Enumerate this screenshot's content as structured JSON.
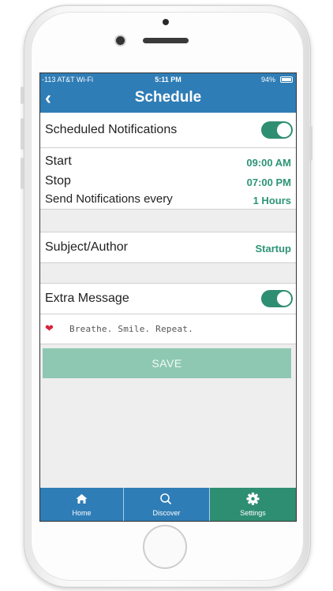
{
  "status_bar": {
    "carrier": "-113 AT&T Wi-Fi",
    "time": "5:11 PM",
    "battery": "94%"
  },
  "nav": {
    "back_icon": "chevron-left-icon",
    "title": "Schedule"
  },
  "settings": {
    "scheduled_notifications": {
      "label": "Scheduled Notifications",
      "enabled": true
    },
    "start": {
      "label": "Start",
      "value": "09:00 AM"
    },
    "stop": {
      "label": "Stop",
      "value": "07:00 PM"
    },
    "frequency": {
      "label": "Send Notifications every",
      "value": "1 Hours"
    },
    "subject": {
      "label": "Subject/Author",
      "value": "Startup"
    },
    "extra_message": {
      "label": "Extra Message",
      "enabled": true,
      "text": "Breathe. Smile. Repeat.",
      "emoji": "heart-icon"
    }
  },
  "save_label": "SAVE",
  "tabs": [
    {
      "label": "Home",
      "icon": "home-icon",
      "active": false
    },
    {
      "label": "Discover",
      "icon": "search-icon",
      "active": false
    },
    {
      "label": "Settings",
      "icon": "gear-icon",
      "active": true
    }
  ],
  "colors": {
    "brand_blue": "#2f7db6",
    "accent_green": "#2e8e72",
    "save_disabled": "#8ec8b3"
  }
}
